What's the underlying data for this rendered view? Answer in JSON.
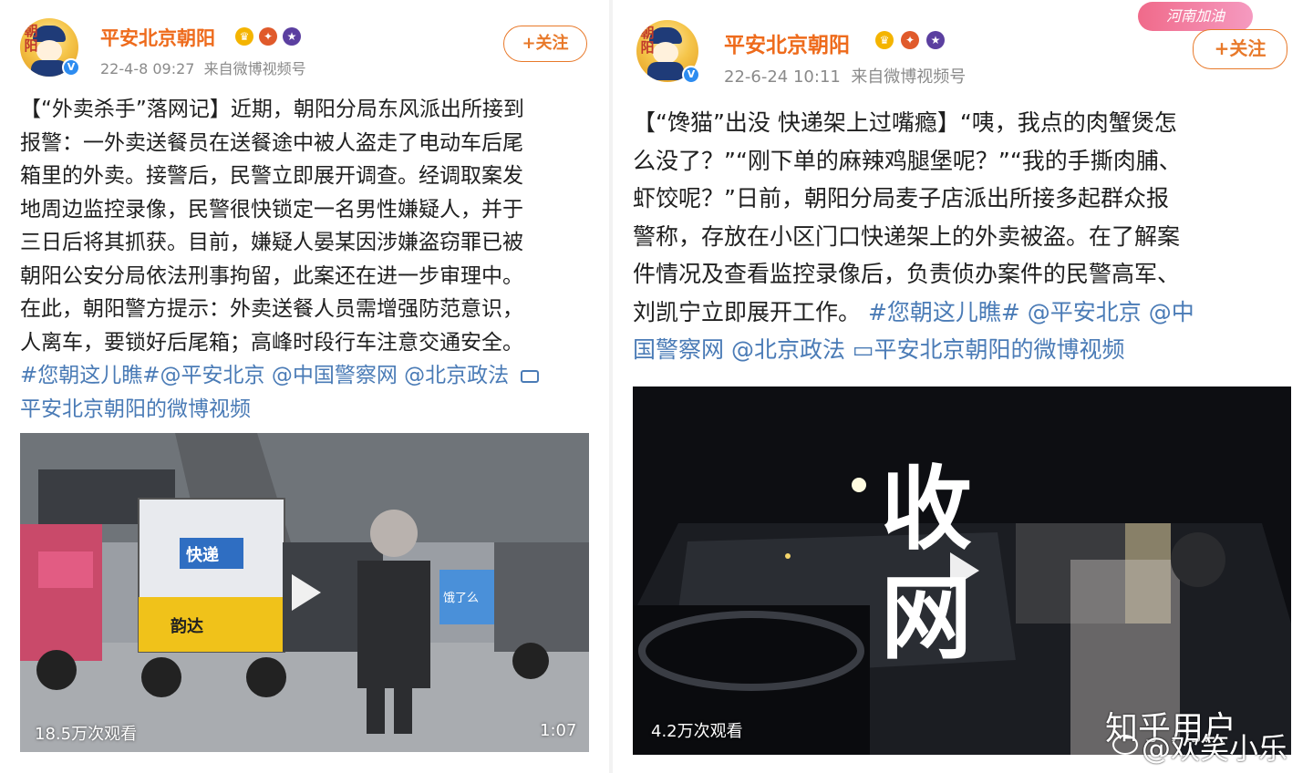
{
  "left_post": {
    "author": "平安北京朝阳",
    "avatar_text": "朝阳",
    "time": "22-4-8 09:27",
    "source": "来自微博视频号",
    "follow_label": "+关注",
    "text_lines": [
      "【“外卖杀手”落网记】近期，朝阳分局东风派出所接到",
      "报警：一外卖送餐员在送餐途中被人盗走了电动车后尾",
      "箱里的外卖。接警后，民警立即展开调查。经调取案发",
      "地周边监控录像，民警很快锁定一名男性嫌疑人，并于",
      "三日后将其抓获。目前，嫌疑人晏某因涉嫌盗窃罪已被",
      "朝阳公安分局依法刑事拘留，此案还在进一步审理中。",
      "在此，朝阳警方提示：外卖送餐人员需增强防范意识，",
      "人离车，要锁好后尾箱；高峰时段行车注意交通安全。"
    ],
    "tags_line1": "#您朝这儿瞧#@平安北京 @中国警察网 @北京政法",
    "tags_line2": "平安北京朝阳的微博视频",
    "video": {
      "views": "18.5万次观看",
      "duration": "1:07",
      "box_label": "快递",
      "brand_label": "韵达",
      "bag_label": "饿了么"
    }
  },
  "right_post": {
    "author": "平安北京朝阳",
    "avatar_text": "朝阳",
    "time": "22-6-24 10:11",
    "source": "来自微博视频号",
    "follow_label": "+关注",
    "sticker": "河南加油",
    "text_lines": [
      "【“馋猫”出没 快递架上过嘴瘾】“咦，我点的肉蟹煲怎",
      "么没了？”“刚下单的麻辣鸡腿堡呢？”“我的手撕肉脯、",
      "虾饺呢？”日前，朝阳分局麦子店派出所接多起群众报",
      "警称，存放在小区门口快递架上的外卖被盗。在了解案",
      "件情况及查看监控录像后，负责侦办案件的民警高军、"
    ],
    "text_line6_plain": "刘凯宁立即展开工作。",
    "text_line6_tags": "#您朝这儿瞧# @平安北京 @中",
    "tags_line7": "国警察网 @北京政法 ▭平安北京朝阳的微博视频",
    "video": {
      "views": "4.2万次观看",
      "overlay_title": "收网"
    }
  },
  "watermark": {
    "zhihu": "知乎用户",
    "weibo": "@欢笑小乐"
  },
  "colors": {
    "brand_orange": "#ee6b1c",
    "link_blue": "#4a7bb6",
    "meta_gray": "#8a8a8a"
  }
}
